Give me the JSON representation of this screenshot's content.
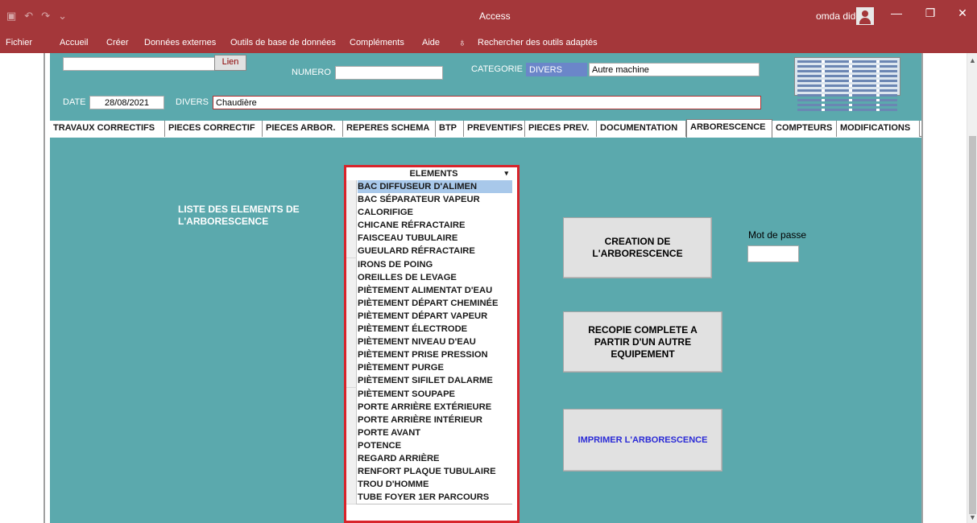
{
  "titlebar": {
    "app_title": "Access",
    "user_name": "omda dido",
    "minimize": "—",
    "restore": "❐",
    "close": "✕"
  },
  "ribbon": {
    "tabs": [
      "Fichier",
      "Accueil",
      "Créer",
      "Données externes",
      "Outils de base de données",
      "Compléments",
      "Aide"
    ],
    "search_label": "Rechercher des outils adaptés"
  },
  "header": {
    "lien_label": "Lien",
    "lien_value": "",
    "numero_label": "NUMERO",
    "numero_value": "",
    "categorie_label": "CATEGORIE",
    "categorie_value": "DIVERS",
    "machine_value": "Autre machine",
    "date_label": "DATE",
    "date_value": "28/08/2021",
    "divers_label": "DIVERS",
    "divers_value": "Chaudière"
  },
  "tabs": [
    "TRAVAUX CORRECTIFS",
    "PIECES CORRECTIF",
    "PIECES ARBOR.",
    "REPERES SCHEMA",
    "BTP",
    "PREVENTIFS",
    "PIECES PREV.",
    "DOCUMENTATION",
    "ARBORESCENCE",
    "COMPTEURS",
    "MODIFICATIONS"
  ],
  "active_tab": "ARBORESCENCE",
  "main": {
    "liste_title_line1": "LISTE DES ELEMENTS DE",
    "liste_title_line2": "L'ARBORESCENCE",
    "list_header": "ELEMENTS",
    "elements": [
      "BAC DIFFUSEUR D'ALIMEN",
      "BAC SÉPARATEUR VAPEUR",
      "CALORIFIGE",
      "CHICANE RÉFRACTAIRE",
      "FAISCEAU TUBULAIRE",
      "GUEULARD RÉFRACTAIRE",
      "IRONS DE POING",
      "OREILLES DE LEVAGE",
      "PIÈTEMENT ALIMENTAT D'EAU",
      "PIÈTEMENT DÉPART CHEMINÉE",
      "PIÈTEMENT DÉPART VAPEUR",
      "PIÈTEMENT ÉLECTRODE",
      "PIÈTEMENT NIVEAU D'EAU",
      "PIÈTEMENT PRISE PRESSION",
      "PIÈTEMENT PURGE",
      "PIÈTEMENT SIFILET DALARME",
      "PIÈTEMENT SOUPAPE",
      "PORTE ARRIÈRE EXTÉRIEURE",
      "PORTE ARRIÈRE INTÉRIEUR",
      "PORTE AVANT",
      "POTENCE",
      "REGARD ARRIÈRE",
      "RENFORT PLAQUE TUBULAIRE",
      "TROU D'HOMME",
      "TUBE FOYER 1ER PARCOURS"
    ],
    "creation_line1": "CREATION DE",
    "creation_line2": "L'ARBORESCENCE",
    "recopie_line1": "RECOPIE COMPLETE A",
    "recopie_line2": "PARTIR D'UN AUTRE",
    "recopie_line3": "EQUIPEMENT",
    "imprimer_label": "IMPRIMER L'ARBORESCENCE",
    "password_label": "Mot de passe",
    "password_value": ""
  },
  "colors": {
    "titlebar": "#a4373a",
    "form_background": "#5ba9ad",
    "list_border": "#d8242b",
    "selected_row": "#a8c8ea",
    "print_text": "#2b2bd6"
  }
}
